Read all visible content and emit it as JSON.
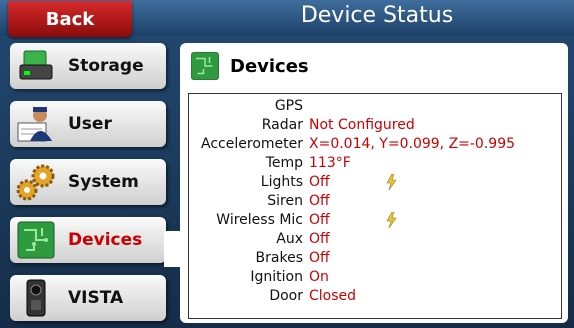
{
  "header": {
    "back_label": "Back",
    "title": "Device Status"
  },
  "nav": {
    "items": [
      {
        "label": "Storage",
        "icon": "storage-icon"
      },
      {
        "label": "User",
        "icon": "user-icon"
      },
      {
        "label": "System",
        "icon": "gears-icon"
      },
      {
        "label": "Devices",
        "icon": "circuit-board-icon",
        "active": true
      },
      {
        "label": "VISTA",
        "icon": "camera-icon"
      }
    ]
  },
  "panel": {
    "title": "Devices",
    "rows": [
      {
        "key": "GPS",
        "value": ""
      },
      {
        "key": "Radar",
        "value": "Not Configured"
      },
      {
        "key": "Accelerometer",
        "value": "X=0.014, Y=0.099, Z=-0.995"
      },
      {
        "key": "Temp",
        "value": "113°F"
      },
      {
        "key": "Lights",
        "value": "Off",
        "icon": "lightning-icon"
      },
      {
        "key": "Siren",
        "value": "Off"
      },
      {
        "key": "Wireless Mic",
        "value": "Off",
        "icon": "lightning-icon"
      },
      {
        "key": "Aux",
        "value": "Off"
      },
      {
        "key": "Brakes",
        "value": "Off"
      },
      {
        "key": "Ignition",
        "value": "On"
      },
      {
        "key": "Door",
        "value": "Closed"
      }
    ]
  },
  "colors": {
    "accent_red": "#cc0000",
    "header_blue": "#2b5a8a",
    "back_red": "#c01a1a"
  }
}
